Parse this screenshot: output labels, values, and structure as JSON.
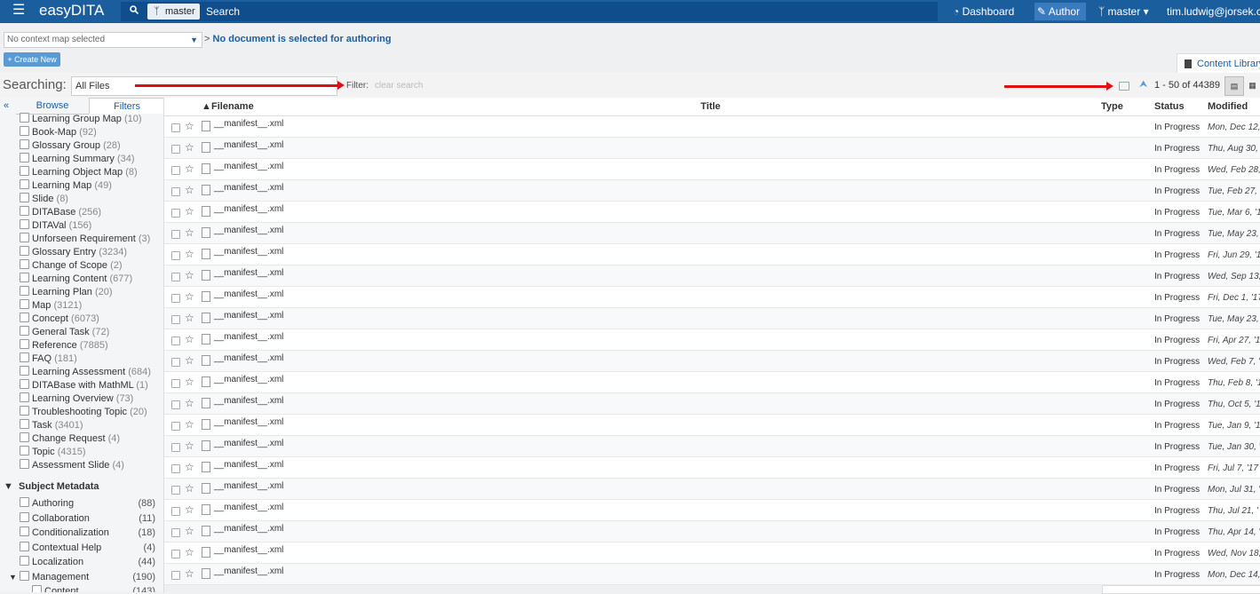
{
  "topbar": {
    "brand": "easyDITA",
    "branch": "master",
    "search_label": "Search",
    "nav_dashboard": "Dashboard",
    "nav_author": "Author",
    "nav_branch": "master",
    "user": "tim.ludwig@jorsek.c"
  },
  "context": {
    "map_select": "No context map selected",
    "no_doc_prefix": ">",
    "no_doc": "No document is selected for authoring"
  },
  "create_new": "+ Create New",
  "content_library_tab": "Content Library",
  "search": {
    "searching_label": "Searching:",
    "scope": "All Files",
    "filter_label": "Filter:",
    "filter_placeholder": "clear search",
    "paging": "1 - 50 of 44389"
  },
  "sidebar": {
    "tab_browse": "Browse",
    "tab_filters": "Filters",
    "types": [
      {
        "label": "Learning Group Map",
        "count": "(10)"
      },
      {
        "label": "Book-Map",
        "count": "(92)"
      },
      {
        "label": "Glossary Group",
        "count": "(28)"
      },
      {
        "label": "Learning Summary",
        "count": "(34)"
      },
      {
        "label": "Learning Object Map",
        "count": "(8)"
      },
      {
        "label": "Learning Map",
        "count": "(49)"
      },
      {
        "label": "Slide",
        "count": "(8)"
      },
      {
        "label": "DITABase",
        "count": "(256)"
      },
      {
        "label": "DITAVal",
        "count": "(156)"
      },
      {
        "label": "Unforseen Requirement",
        "count": "(3)"
      },
      {
        "label": "Glossary Entry",
        "count": "(3234)"
      },
      {
        "label": "Change of Scope",
        "count": "(2)"
      },
      {
        "label": "Learning Content",
        "count": "(677)"
      },
      {
        "label": "Learning Plan",
        "count": "(20)"
      },
      {
        "label": "Map",
        "count": "(3121)"
      },
      {
        "label": "Concept",
        "count": "(6073)"
      },
      {
        "label": "General Task",
        "count": "(72)"
      },
      {
        "label": "Reference",
        "count": "(7885)"
      },
      {
        "label": "FAQ",
        "count": "(181)"
      },
      {
        "label": "Learning Assessment",
        "count": "(684)"
      },
      {
        "label": "DITABase with MathML",
        "count": "(1)"
      },
      {
        "label": "Learning Overview",
        "count": "(73)"
      },
      {
        "label": "Troubleshooting Topic",
        "count": "(20)"
      },
      {
        "label": "Task",
        "count": "(3401)"
      },
      {
        "label": "Change Request",
        "count": "(4)"
      },
      {
        "label": "Topic",
        "count": "(4315)"
      },
      {
        "label": "Assessment Slide",
        "count": "(4)"
      }
    ],
    "subject_metadata_header": "Subject Metadata",
    "subject_metadata": [
      {
        "label": "Authoring",
        "count": "(88)"
      },
      {
        "label": "Collaboration",
        "count": "(11)"
      },
      {
        "label": "Conditionalization",
        "count": "(18)"
      },
      {
        "label": "Contextual Help",
        "count": "(4)"
      },
      {
        "label": "Localization",
        "count": "(44)"
      },
      {
        "label": "Management",
        "count": "(190)"
      },
      {
        "label": "Content",
        "count": "(143)"
      }
    ]
  },
  "table": {
    "col_filename": "Filename",
    "col_title": "Title",
    "col_type": "Type",
    "col_status": "Status",
    "col_modified": "Modified",
    "rows": [
      {
        "file": "__manifest__.xml",
        "status": "In Progress",
        "modified": "Mon, Dec 12,"
      },
      {
        "file": "__manifest__.xml",
        "status": "In Progress",
        "modified": "Thu, Aug 30,"
      },
      {
        "file": "__manifest__.xml",
        "status": "In Progress",
        "modified": "Wed, Feb 28,"
      },
      {
        "file": "__manifest__.xml",
        "status": "In Progress",
        "modified": "Tue, Feb 27, '"
      },
      {
        "file": "__manifest__.xml",
        "status": "In Progress",
        "modified": "Tue, Mar 6, '1"
      },
      {
        "file": "__manifest__.xml",
        "status": "In Progress",
        "modified": "Tue, May 23,"
      },
      {
        "file": "__manifest__.xml",
        "status": "In Progress",
        "modified": "Fri, Jun 29, '1"
      },
      {
        "file": "__manifest__.xml",
        "status": "In Progress",
        "modified": "Wed, Sep 13,"
      },
      {
        "file": "__manifest__.xml",
        "status": "In Progress",
        "modified": "Fri, Dec 1, '17"
      },
      {
        "file": "__manifest__.xml",
        "status": "In Progress",
        "modified": "Tue, May 23,"
      },
      {
        "file": "__manifest__.xml",
        "status": "In Progress",
        "modified": "Fri, Apr 27, '1"
      },
      {
        "file": "__manifest__.xml",
        "status": "In Progress",
        "modified": "Wed, Feb 7, '"
      },
      {
        "file": "__manifest__.xml",
        "status": "In Progress",
        "modified": "Thu, Feb 8, '1"
      },
      {
        "file": "__manifest__.xml",
        "status": "In Progress",
        "modified": "Thu, Oct 5, '1"
      },
      {
        "file": "__manifest__.xml",
        "status": "In Progress",
        "modified": "Tue, Jan 9, '1"
      },
      {
        "file": "__manifest__.xml",
        "status": "In Progress",
        "modified": "Tue, Jan 30, '"
      },
      {
        "file": "__manifest__.xml",
        "status": "In Progress",
        "modified": "Fri, Jul 7, '17"
      },
      {
        "file": "__manifest__.xml",
        "status": "In Progress",
        "modified": "Mon, Jul 31, '"
      },
      {
        "file": "__manifest__.xml",
        "status": "In Progress",
        "modified": "Thu, Jul 21, '"
      },
      {
        "file": "__manifest__.xml",
        "status": "In Progress",
        "modified": "Thu, Apr 14, '"
      },
      {
        "file": "__manifest__.xml",
        "status": "In Progress",
        "modified": "Wed, Nov 18,"
      },
      {
        "file": "__manifest__.xml",
        "status": "In Progress",
        "modified": "Mon, Dec 14,"
      }
    ]
  }
}
